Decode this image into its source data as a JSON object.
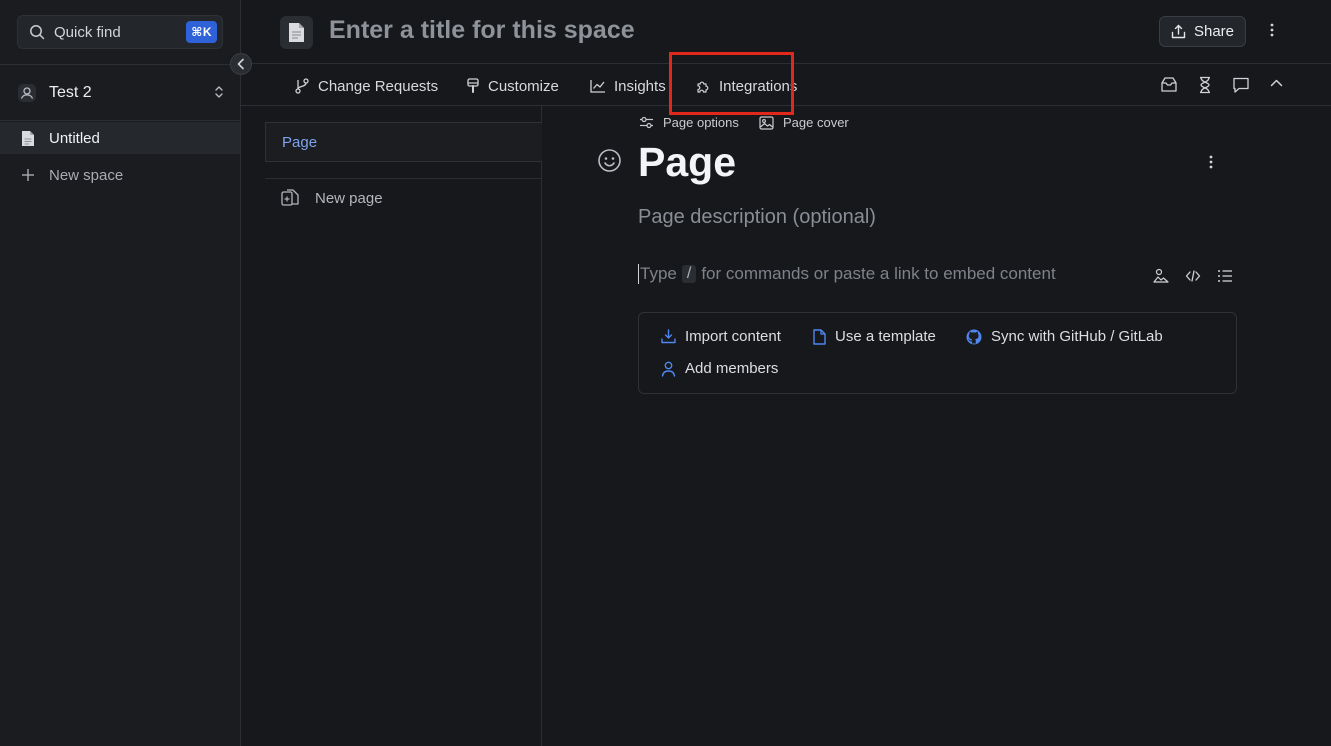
{
  "sidebar": {
    "quick_find": {
      "label": "Quick find",
      "shortcut": "⌘K"
    },
    "organization": {
      "name": "Test 2"
    },
    "items": [
      {
        "label": "Untitled",
        "active": true
      },
      {
        "label": "New space",
        "active": false
      }
    ]
  },
  "header": {
    "title_placeholder": "Enter a title for this space",
    "share_label": "Share"
  },
  "toolbar": {
    "tabs": [
      {
        "label": "Change Requests",
        "icon": "branch-icon"
      },
      {
        "label": "Customize",
        "icon": "brush-icon"
      },
      {
        "label": "Insights",
        "icon": "chart-line-icon"
      },
      {
        "label": "Integrations",
        "icon": "puzzle-icon",
        "highlighted": true
      }
    ],
    "right_icons": [
      "inbox-icon",
      "hourglass-icon",
      "comment-icon",
      "chevron-up-icon"
    ],
    "highlight_color": "#e2281b"
  },
  "page_tree": {
    "current_page": "Page",
    "new_page_label": "New page"
  },
  "editor": {
    "page_options_label": "Page options",
    "page_cover_label": "Page cover",
    "title": "Page",
    "description_placeholder": "Page description (optional)",
    "command_hint": {
      "prefix": "Type",
      "key": "/",
      "suffix": "for commands or paste a link to embed content"
    },
    "actions": [
      {
        "label": "Import content",
        "icon": "import-icon"
      },
      {
        "label": "Use a template",
        "icon": "file-icon"
      },
      {
        "label": "Sync with GitHub / GitLab",
        "icon": "github-icon"
      },
      {
        "label": "Add members",
        "icon": "user-icon"
      }
    ]
  },
  "colors": {
    "background": "#16181c",
    "sidebar": "#1a1c20",
    "accent_blue": "#2f62d8",
    "link_blue": "#7ea3ec"
  }
}
